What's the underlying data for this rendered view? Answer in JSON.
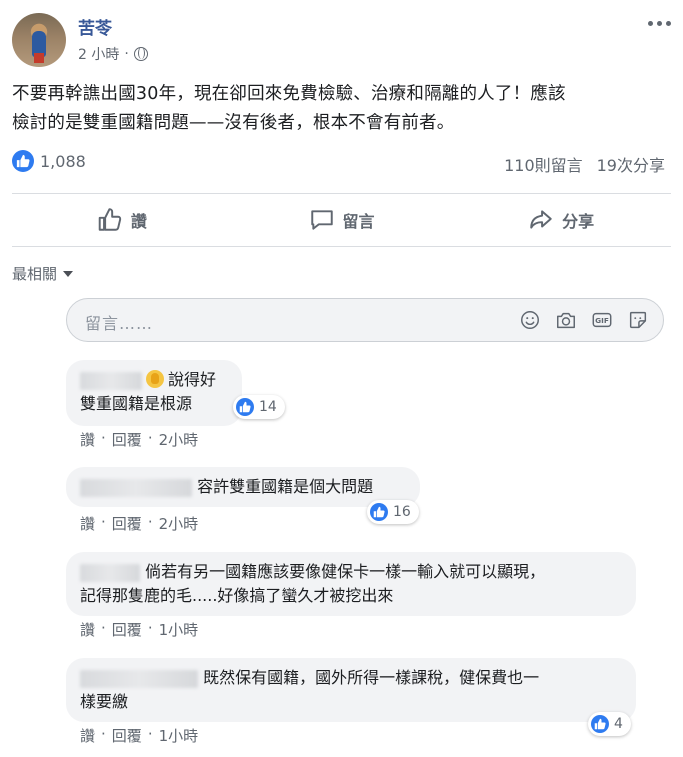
{
  "post": {
    "author": "苦苓",
    "time": "2 小時",
    "separator": "·",
    "text_line1": "不要再幹譙出國30年，現在卻回來免費檢驗、治療和隔離的人了！應該",
    "text_line2": "檢討的是雙重國籍問題——沒有後者，根本不會有前者。",
    "like_count": "1,088",
    "comments_count": "110則留言",
    "shares_count": "19次分享"
  },
  "actions": {
    "like": "讚",
    "comment": "留言",
    "share": "分享"
  },
  "sort": {
    "label": "最相關"
  },
  "composer": {
    "placeholder": "留言……"
  },
  "comments": [
    {
      "line1": "說得好",
      "line2": "雙重國籍是根源",
      "reactions": "14",
      "like": "讚",
      "reply": "回覆",
      "time": "2小時"
    },
    {
      "line1": "容許雙重國籍是個大問題",
      "reactions": "16",
      "like": "讚",
      "reply": "回覆",
      "time": "2小時"
    },
    {
      "line1": "倘若有另一國籍應該要像健保卡一樣一輸入就可以顯現，",
      "line2": "記得那隻鹿的毛.....好像搞了蠻久才被挖出來",
      "like": "讚",
      "reply": "回覆",
      "time": "1小時"
    },
    {
      "line1": "既然保有國籍，國外所得一樣課稅，健保費也一",
      "line2": "樣要繳",
      "reactions": "4",
      "like": "讚",
      "reply": "回覆",
      "time": "1小時"
    }
  ],
  "colors": {
    "brand_blue": "#385898",
    "like_blue": "#2e7bf0",
    "meta_gray": "#606770",
    "bubble_bg": "#f2f3f5"
  },
  "icons": [
    "globe-icon",
    "more-options-icon",
    "like-icon",
    "comment-icon",
    "share-icon",
    "caret-down-icon",
    "emoji-icon",
    "camera-icon",
    "gif-icon",
    "sticker-icon",
    "clap-emoji-icon"
  ]
}
